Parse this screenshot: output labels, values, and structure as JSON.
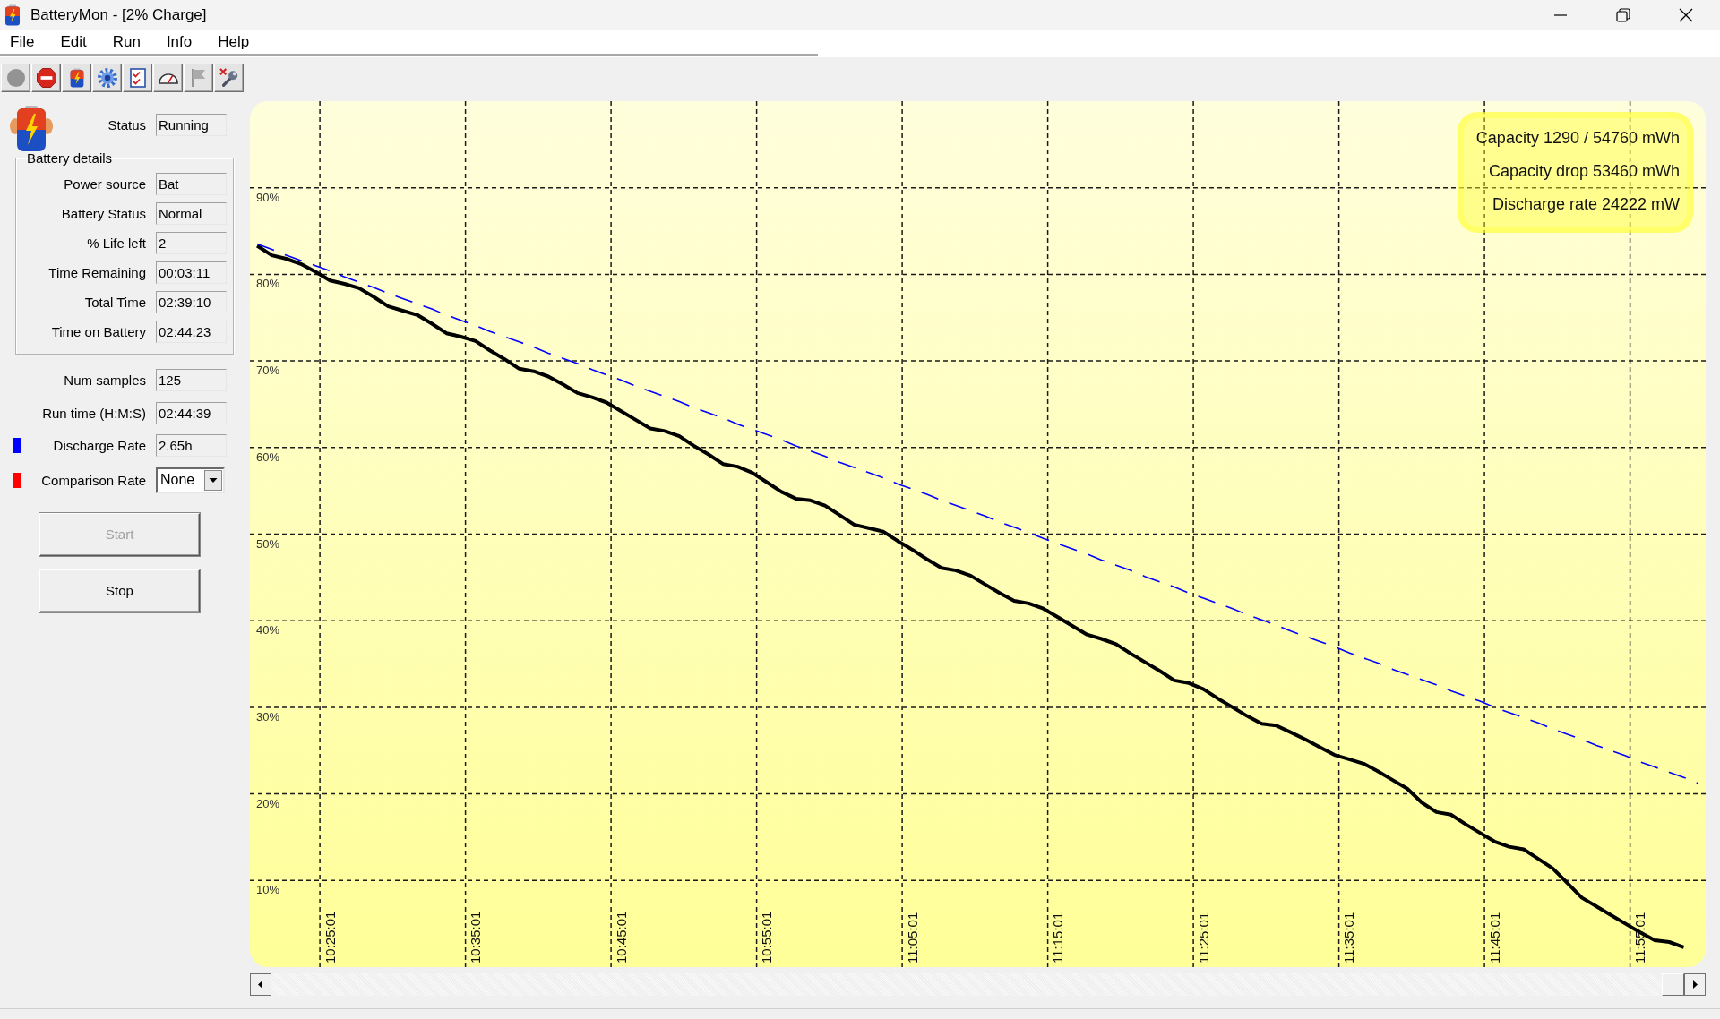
{
  "window": {
    "title": "BatteryMon - [2% Charge]"
  },
  "menu": [
    "File",
    "Edit",
    "Run",
    "Info",
    "Help"
  ],
  "toolbar": [
    {
      "disabled": true
    },
    {
      "disabled": false
    },
    {
      "disabled": false
    },
    {
      "disabled": false
    },
    {
      "disabled": false
    },
    {
      "disabled": false
    },
    {
      "disabled": true
    },
    {
      "disabled": false
    }
  ],
  "status": {
    "label": "Status",
    "value": "Running"
  },
  "battery_details": {
    "title": "Battery details",
    "fields": [
      {
        "label": "Power source",
        "value": "Bat"
      },
      {
        "label": "Battery Status",
        "value": "Normal"
      },
      {
        "label": "% Life left",
        "value": "2"
      },
      {
        "label": "Time Remaining",
        "value": "00:03:11"
      },
      {
        "label": "Total Time",
        "value": "02:39:10"
      },
      {
        "label": "Time on Battery",
        "value": "02:44:23"
      }
    ]
  },
  "stats": [
    {
      "kind": "field",
      "label": "Num samples",
      "value": "125"
    },
    {
      "kind": "field",
      "label": "Run time (H:M:S)",
      "value": "02:44:39"
    },
    {
      "kind": "field",
      "label": "Discharge Rate",
      "value": "2.65h",
      "color": "#0000ff"
    },
    {
      "kind": "dropdown",
      "label": "Comparison Rate",
      "value": "None",
      "color": "#ff0000"
    }
  ],
  "buttons": [
    {
      "label": "Start",
      "disabled": true
    },
    {
      "label": "Stop",
      "disabled": false
    }
  ],
  "chart": {
    "chart_data": {
      "type": "line",
      "grid": true,
      "ylim": [
        0,
        100
      ],
      "categories": [
        null,
        null,
        null,
        null,
        null,
        "10:25:01",
        null,
        null,
        null,
        null,
        null,
        null,
        null,
        null,
        null,
        "10:35:01",
        null,
        null,
        null,
        null,
        null,
        null,
        null,
        null,
        null,
        "10:45:01",
        null,
        null,
        null,
        null,
        null,
        null,
        null,
        null,
        null,
        "10:55:01",
        null,
        null,
        null,
        null,
        null,
        null,
        null,
        null,
        null,
        "11:05:01",
        null,
        null,
        null,
        null,
        null,
        null,
        null,
        null,
        null,
        "11:15:01",
        null,
        null,
        null,
        null,
        null,
        null,
        null,
        null,
        null,
        "11:25:01",
        null,
        null,
        null,
        null,
        null,
        null,
        null,
        null,
        null,
        "11:35:01",
        null,
        null,
        null,
        null,
        null,
        null,
        null,
        null,
        null,
        "11:45:01",
        null,
        null,
        null,
        null,
        null,
        null,
        null,
        null,
        null,
        "11:55:01",
        null,
        null,
        null,
        null
      ],
      "yticks": [
        {
          "value": 10,
          "label": "10%"
        },
        {
          "value": 20,
          "label": "20%"
        },
        {
          "value": 30,
          "label": "30%"
        },
        {
          "value": 40,
          "label": "40%"
        },
        {
          "value": 50,
          "label": "50%"
        },
        {
          "value": 60,
          "label": "60%"
        },
        {
          "value": 70,
          "label": "70%"
        },
        {
          "value": 80,
          "label": "80%"
        },
        {
          "value": 90,
          "label": "90%"
        }
      ],
      "series": [
        {
          "color": "#000000",
          "line_style": "solid",
          "values": [
            83.3,
            82.2,
            81.8,
            81.2,
            80.3,
            79.3,
            78.9,
            78.4,
            77.4,
            76.3,
            75.8,
            75.3,
            74.3,
            73.2,
            72.8,
            72.3,
            71.2,
            70.2,
            69.1,
            68.8,
            68.2,
            67.3,
            66.3,
            65.8,
            65.2,
            64.2,
            63.2,
            62.2,
            61.9,
            61.3,
            60.2,
            59.2,
            58.1,
            57.8,
            57.1,
            56.0,
            54.9,
            54.1,
            53.9,
            53.3,
            52.2,
            51.1,
            50.7,
            50.3,
            49.2,
            48.2,
            47.1,
            46.1,
            45.8,
            45.2,
            44.2,
            43.2,
            42.3,
            42.0,
            41.4,
            40.4,
            39.4,
            38.4,
            37.9,
            37.3,
            36.2,
            35.2,
            34.2,
            33.1,
            32.8,
            32.1,
            31.0,
            30.0,
            29.0,
            28.1,
            27.9,
            27.1,
            26.3,
            25.4,
            24.5,
            24.0,
            23.5,
            22.6,
            21.6,
            20.6,
            19.0,
            17.9,
            17.6,
            16.5,
            15.5,
            14.5,
            13.9,
            13.6,
            12.5,
            11.4,
            9.7,
            8.0,
            7.0,
            6.0,
            5.0,
            4.0,
            3.1,
            2.9,
            2.3,
            null
          ]
        },
        {
          "color": "#0000ff",
          "line_style": "dashed",
          "values": [
            83.5,
            82.9,
            82.2,
            81.6,
            81.0,
            80.4,
            79.7,
            79.1,
            78.5,
            77.8,
            77.2,
            76.6,
            76.0,
            75.3,
            74.7,
            74.1,
            73.4,
            72.8,
            72.2,
            71.6,
            70.9,
            70.3,
            69.7,
            69.0,
            68.4,
            67.8,
            67.1,
            66.5,
            65.9,
            65.3,
            64.6,
            64.0,
            63.4,
            62.7,
            62.1,
            61.5,
            60.9,
            60.2,
            59.6,
            59.0,
            58.3,
            57.7,
            57.1,
            56.5,
            55.8,
            55.2,
            54.6,
            53.9,
            53.3,
            52.7,
            52.1,
            51.4,
            50.8,
            50.2,
            49.5,
            48.9,
            48.3,
            47.7,
            47.0,
            46.4,
            45.8,
            45.1,
            44.5,
            43.9,
            43.2,
            42.6,
            42.0,
            41.4,
            40.7,
            40.1,
            39.5,
            38.8,
            38.2,
            37.6,
            37.0,
            36.3,
            35.7,
            35.1,
            34.4,
            33.8,
            33.2,
            32.6,
            31.9,
            31.3,
            30.7,
            30.0,
            29.4,
            28.8,
            28.2,
            27.5,
            26.9,
            26.3,
            25.6,
            25.0,
            24.4,
            23.7,
            23.1,
            22.5,
            21.9,
            21.2
          ]
        }
      ],
      "annotations": [
        "Capacity 1290 / 54760 mWh",
        "Capacity drop 53460 mWh",
        "Discharge rate 24222 mW"
      ]
    }
  }
}
